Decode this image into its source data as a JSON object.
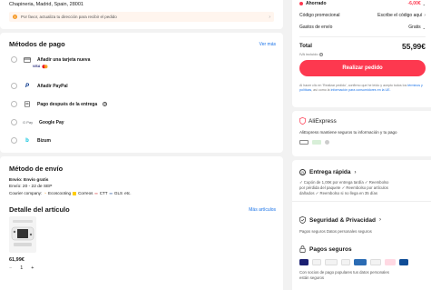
{
  "address": {
    "line": "Chapineria, Madrid, Spain, 28001",
    "warning": "Por favor, actualiza tu dirección para recibir el pedido"
  },
  "payment": {
    "title": "Métodos de pago",
    "see_more": "Ver más",
    "options": [
      {
        "label": "Añadir una tarjeta nueva",
        "icon": "credit-card-icon"
      },
      {
        "label": "Añadir PayPal",
        "icon": "paypal-icon"
      },
      {
        "label": "Pago después de la entrega",
        "icon": "invoice-icon"
      },
      {
        "label": "Google Pay",
        "icon": "google-pay-icon",
        "prefix": "G Pay"
      },
      {
        "label": "Bizum",
        "icon": "bizum-icon"
      }
    ]
  },
  "shipping": {
    "title": "Método de envío",
    "line1": "Envío: Envío gratis",
    "line2": "Envío: 20 - 22 de SEP",
    "line3_prefix": "Courier company:",
    "couriers": [
      "Ecoscooting",
      "Correos",
      "CTT",
      "GLS",
      "etc."
    ]
  },
  "item": {
    "title": "Detalle del artículo",
    "more": "Más artículos",
    "price": "61,99€",
    "qty": "1",
    "minus": "−",
    "plus": "+"
  },
  "summary": {
    "saved_label": "Ahorrado",
    "saved_value": "-6,00€",
    "promo_label": "Código promocional",
    "promo_value": "Escribe el código aquí",
    "shipping_label": "Gastos de envío",
    "shipping_value": "Gratis",
    "total_label": "Total",
    "total_value": "55,99€",
    "vat": "IVA incluido",
    "order_button": "Realizar pedido",
    "legal_1": "Al hacer clic en 'Realizar pedido', confirmo que he leído y",
    "legal_2": "acepto todos los",
    "legal_link1": "términos y políticas",
    "legal_3": ", así como la",
    "legal_link2": "información",
    "legal_link3": "para consumidores en la UE."
  },
  "aliexpress": {
    "brand": "AliExpress",
    "text": "AliExpress mantiene seguros tu información y tu pago"
  },
  "delivery": {
    "title": "Entrega rápida",
    "line1": "✓ Cupón de 1,00€ por entrega tardía  ✓ Reembolso",
    "line2": "por pérdida del paquete  ✓ Reembolso por artículos",
    "line3": "dañados  ✓ Reembolso si no llega en 35 días"
  },
  "security": {
    "title": "Seguridad & Privacidad",
    "text": "Pagos seguros   Datos personales seguros"
  },
  "safe_pay": {
    "title": "Pagos seguros",
    "text1": "Con socios de pago populares tus datos personales",
    "text2": "están seguros",
    "badges": [
      "VISA",
      "MC",
      "AMEX",
      "Maestro",
      "SafeKey",
      "PayPal",
      "Klarna",
      "JCB"
    ]
  },
  "colors": {
    "accent": "#fd384f",
    "green": "#1aa35b"
  }
}
